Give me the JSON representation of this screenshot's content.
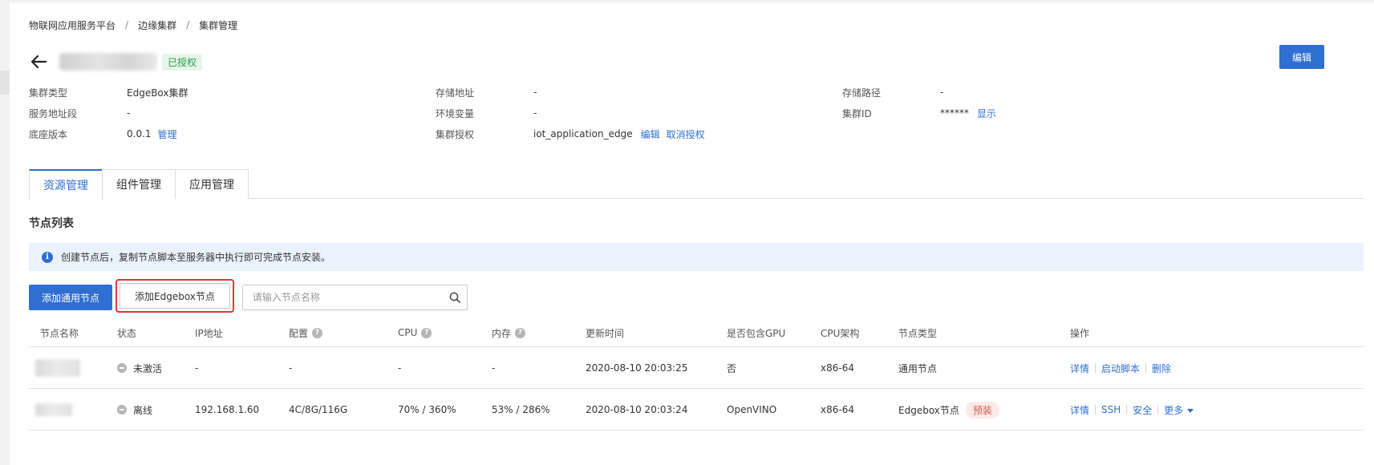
{
  "breadcrumb": [
    "物联网应用服务平台",
    "边缘集群",
    "集群管理"
  ],
  "breadcrumb_sep": "/",
  "header": {
    "auth_badge": "已授权",
    "edit_button": "编辑"
  },
  "info": {
    "cluster_type_label": "集群类型",
    "cluster_type_value": "EdgeBox集群",
    "storage_addr_label": "存储地址",
    "storage_addr_value": "-",
    "storage_path_label": "存储路径",
    "storage_path_value": "-",
    "service_addr_label": "服务地址段",
    "service_addr_value": "-",
    "env_label": "环境变量",
    "env_value": "-",
    "cluster_id_label": "集群ID",
    "cluster_id_value": "******",
    "cluster_id_show": "显示",
    "base_version_label": "底座版本",
    "base_version_value": "0.0.1",
    "base_version_manage": "管理",
    "auth_label": "集群授权",
    "auth_value": "iot_application_edge",
    "auth_edit": "编辑",
    "auth_revoke": "取消授权"
  },
  "tabs": [
    "资源管理",
    "组件管理",
    "应用管理"
  ],
  "section_title": "节点列表",
  "alert_text": "创建节点后，复制节点脚本至服务器中执行即可完成节点安装。",
  "toolbar": {
    "add_general": "添加通用节点",
    "add_edgebox": "添加Edgebox节点",
    "search_placeholder": "请输入节点名称"
  },
  "table": {
    "headers": [
      "节点名称",
      "状态",
      "IP地址",
      "配置",
      "CPU",
      "内存",
      "更新时间",
      "是否包含GPU",
      "CPU架构",
      "节点类型",
      "操作"
    ],
    "rows": [
      {
        "status": "未激活",
        "ip": "-",
        "config": "-",
        "cpu": "-",
        "memory": "-",
        "updated": "2020-08-10 20:03:25",
        "gpu": "否",
        "arch": "x86-64",
        "type": "通用节点",
        "type_tag": "",
        "ops": [
          "详情",
          "启动脚本",
          "删除"
        ]
      },
      {
        "status": "离线",
        "ip": "192.168.1.60",
        "config": "4C/8G/116G",
        "cpu": "70% / 360%",
        "memory": "53% / 286%",
        "updated": "2020-08-10 20:03:24",
        "gpu": "OpenVINO",
        "arch": "x86-64",
        "type": "Edgebox节点",
        "type_tag": "预装",
        "ops": [
          "详情",
          "SSH",
          "安全",
          "更多"
        ]
      }
    ]
  },
  "colors": {
    "primary": "#2f6fd1",
    "success": "#2f9a45",
    "highlight_border": "#d83a3a",
    "tag_red": "#d95c4c"
  }
}
